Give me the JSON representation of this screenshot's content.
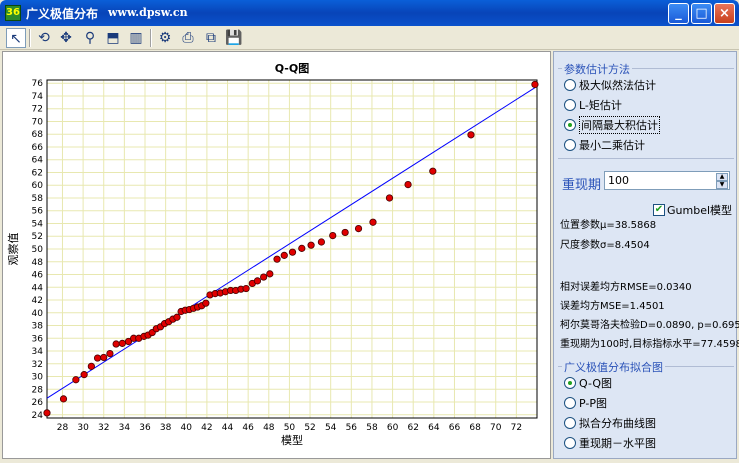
{
  "window": {
    "icon_text": "36",
    "title": "广义极值分布",
    "url": "www.dpsw.cn"
  },
  "titlebar_buttons": {
    "minimize": "_",
    "maximize": "□",
    "close": "×"
  },
  "toolbar": [
    {
      "name": "pointer-tool",
      "glyph": "↖"
    },
    {
      "name": "rotate-tool",
      "glyph": "⟲"
    },
    {
      "name": "move-tool",
      "glyph": "✥"
    },
    {
      "name": "zoom-tool",
      "glyph": "⚲"
    },
    {
      "name": "export-tool",
      "glyph": "⬒"
    },
    {
      "name": "chart-tool",
      "glyph": "▥"
    },
    {
      "name": "settings-tool",
      "glyph": "⚙"
    },
    {
      "name": "print-tool",
      "glyph": "⎙"
    },
    {
      "name": "copy-tool",
      "glyph": "⧉"
    },
    {
      "name": "save-tool",
      "glyph": "💾"
    }
  ],
  "panel": {
    "method_title": "参数估计方法",
    "methods": [
      {
        "label": "极大似然法估计",
        "selected": false
      },
      {
        "label": "L-矩估计",
        "selected": false
      },
      {
        "label": "间隔最大积估计",
        "selected": true
      },
      {
        "label": "最小二乘估计",
        "selected": false
      }
    ],
    "return_period_label": "重现期",
    "return_period_value": "100",
    "gumbel_label": "Gumbel模型",
    "gumbel_checked": true,
    "location_param": "位置参数μ=38.5868",
    "scale_param": "尺度参数σ=8.4504",
    "rmse_rel": "相对误差均方RMSE=0.0340",
    "mse": "误差均方MSE=1.4501",
    "ks_test": "柯尔莫哥洛夫检验D=0.0890, p=0.6954",
    "return_level": "重现期为100时,目标指标水平=77.4598",
    "plot_title": "广义极值分布拟合图",
    "plots": [
      {
        "label": "Q-Q图",
        "selected": true
      },
      {
        "label": "P-P图",
        "selected": false
      },
      {
        "label": "拟合分布曲线图",
        "selected": false
      },
      {
        "label": "重现期－水平图",
        "selected": false
      }
    ]
  },
  "colors": {
    "point": "#e00000",
    "line": "#0000ff",
    "grid": "#e8e8b0"
  },
  "chart_data": {
    "type": "scatter",
    "title": "Q-Q图",
    "xlabel": "模型",
    "ylabel": "观察值",
    "xlim": [
      26.5,
      74
    ],
    "ylim": [
      23.5,
      76.5
    ],
    "xticks": [
      28,
      30,
      32,
      34,
      36,
      38,
      40,
      42,
      44,
      46,
      48,
      50,
      52,
      54,
      56,
      58,
      60,
      62,
      64,
      66,
      68,
      70,
      72
    ],
    "yticks": [
      24,
      26,
      28,
      30,
      32,
      34,
      36,
      38,
      40,
      42,
      44,
      46,
      48,
      50,
      52,
      54,
      56,
      58,
      60,
      62,
      64,
      66,
      68,
      70,
      72,
      74,
      76
    ],
    "grid": true,
    "reference_line": {
      "x": [
        26.5,
        73.8
      ],
      "y": [
        26.6,
        75.3
      ]
    },
    "points": [
      [
        26.5,
        24.3
      ],
      [
        28.1,
        26.5
      ],
      [
        29.3,
        29.5
      ],
      [
        30.1,
        30.3
      ],
      [
        30.8,
        31.6
      ],
      [
        31.4,
        32.9
      ],
      [
        32.0,
        33.0
      ],
      [
        32.6,
        33.6
      ],
      [
        33.2,
        35.1
      ],
      [
        33.8,
        35.2
      ],
      [
        34.4,
        35.5
      ],
      [
        34.9,
        36.0
      ],
      [
        35.4,
        36.0
      ],
      [
        35.9,
        36.3
      ],
      [
        36.3,
        36.5
      ],
      [
        36.7,
        36.9
      ],
      [
        37.1,
        37.5
      ],
      [
        37.5,
        37.8
      ],
      [
        37.9,
        38.3
      ],
      [
        38.3,
        38.6
      ],
      [
        38.7,
        39.0
      ],
      [
        39.1,
        39.3
      ],
      [
        39.5,
        40.2
      ],
      [
        39.9,
        40.4
      ],
      [
        40.3,
        40.5
      ],
      [
        40.7,
        40.7
      ],
      [
        41.1,
        40.9
      ],
      [
        41.5,
        41.1
      ],
      [
        41.9,
        41.5
      ],
      [
        42.3,
        42.8
      ],
      [
        42.8,
        43.0
      ],
      [
        43.3,
        43.1
      ],
      [
        43.8,
        43.3
      ],
      [
        44.3,
        43.5
      ],
      [
        44.8,
        43.5
      ],
      [
        45.3,
        43.7
      ],
      [
        45.8,
        43.8
      ],
      [
        46.4,
        44.6
      ],
      [
        46.9,
        45.0
      ],
      [
        47.5,
        45.6
      ],
      [
        48.1,
        46.1
      ],
      [
        48.8,
        48.4
      ],
      [
        49.5,
        49.0
      ],
      [
        50.3,
        49.5
      ],
      [
        51.2,
        50.1
      ],
      [
        52.1,
        50.6
      ],
      [
        53.1,
        51.1
      ],
      [
        54.2,
        52.1
      ],
      [
        55.4,
        52.6
      ],
      [
        56.7,
        53.2
      ],
      [
        58.1,
        54.2
      ],
      [
        59.7,
        58.0
      ],
      [
        61.5,
        60.1
      ],
      [
        63.9,
        62.2
      ],
      [
        67.6,
        67.9
      ],
      [
        73.8,
        75.8
      ]
    ]
  }
}
